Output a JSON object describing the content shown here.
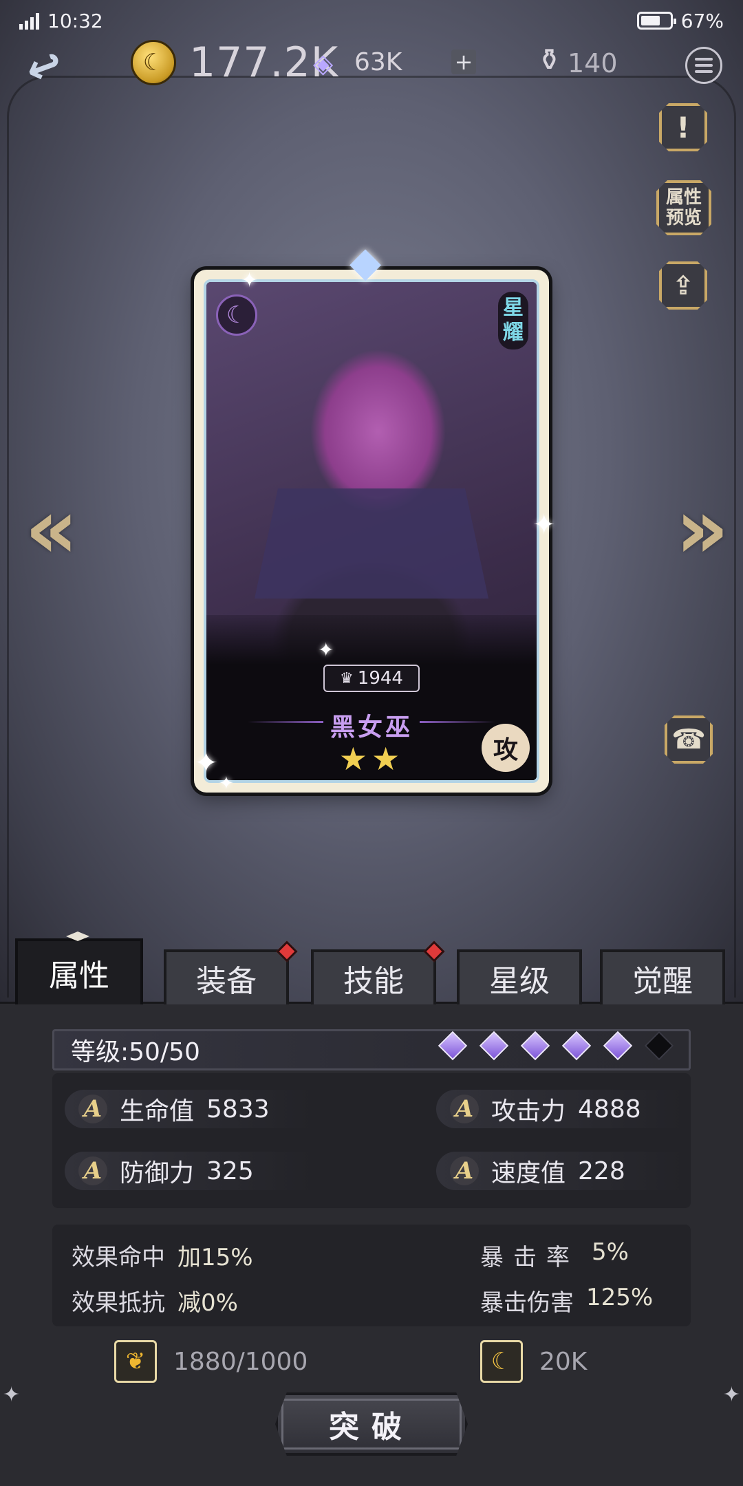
{
  "status": {
    "time": "10:32",
    "battery": "67%",
    "battery_level": 0.67
  },
  "resources": {
    "gold": "177.2K",
    "gems": "63K",
    "ink": "140"
  },
  "side_buttons": {
    "preview": "属性\n预览"
  },
  "hero": {
    "power": "1944",
    "name": "黑女巫",
    "faction": "星耀",
    "role": "攻",
    "stars": "★★",
    "star_count": 2
  },
  "tabs": [
    {
      "label": "属性",
      "active": true,
      "dot": false
    },
    {
      "label": "装备",
      "active": false,
      "dot": true
    },
    {
      "label": "技能",
      "active": false,
      "dot": true
    },
    {
      "label": "星级",
      "active": false,
      "dot": false
    },
    {
      "label": "觉醒",
      "active": false,
      "dot": false
    }
  ],
  "level": {
    "text": "等级:50/50",
    "gems_filled": 5,
    "gems_total": 6
  },
  "stats": [
    {
      "label": "生命值",
      "value": "5833"
    },
    {
      "label": "攻击力",
      "value": "4888"
    },
    {
      "label": "防御力",
      "value": "325"
    },
    {
      "label": "速度值",
      "value": "228"
    }
  ],
  "effects": [
    {
      "label": "效果命中",
      "value": "加15%"
    },
    {
      "label": "效果抵抗",
      "value": "减0%"
    },
    {
      "label": "暴击率",
      "value": "5%"
    },
    {
      "label": "暴击伤害",
      "value": "125%"
    }
  ],
  "costs": {
    "material": "1880/1000",
    "gold": "20K"
  },
  "action": {
    "breakthrough": "突破"
  }
}
